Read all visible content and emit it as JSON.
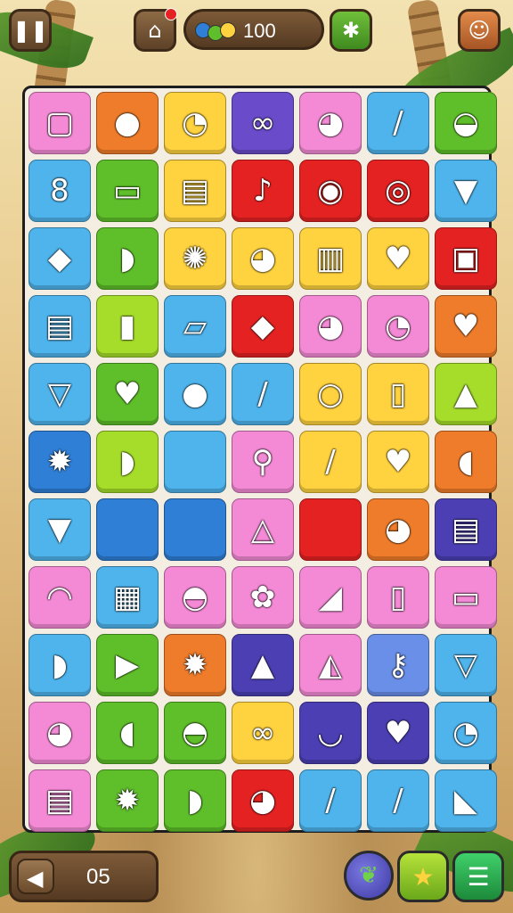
{
  "header": {
    "pause_icon": "pause-icon",
    "home_icon": "home-icon",
    "coins": "100",
    "map_icon": "world-map-icon",
    "avatar_icon": "player-avatar-icon"
  },
  "footer": {
    "back_icon": "back-arrow-icon",
    "level": "05",
    "leaf_icon": "leaf-powerup-icon",
    "star_icon": "star-icon",
    "menu_icon": "menu-icon"
  },
  "board": {
    "rows": [
      [
        {
          "c": "#f48ad6",
          "i": "tablet-icon",
          "g": "▢"
        },
        {
          "c": "#ef7c2a",
          "i": "red-monster-icon",
          "g": "●"
        },
        {
          "c": "#ffd23f",
          "i": "white-bear-icon",
          "g": "◔"
        },
        {
          "c": "#6a4bc9",
          "i": "glasses-icon",
          "g": "∞"
        },
        {
          "c": "#f48ad6",
          "i": "yellow-mouse-icon",
          "g": "◕"
        },
        {
          "c": "#4fb4ec",
          "i": "green-pen-icon",
          "g": "/"
        },
        {
          "c": "#5fbf2a",
          "i": "yellow-chick-icon",
          "g": "◒"
        }
      ],
      [
        {
          "c": "#4fb4ec",
          "i": "peanut-icon",
          "g": "8"
        },
        {
          "c": "#5fbf2a",
          "i": "scroll-icon",
          "g": "▭"
        },
        {
          "c": "#ffd23f",
          "i": "books-icon",
          "g": "▤"
        },
        {
          "c": "#e52222",
          "i": "rattle-icon",
          "g": "♪"
        },
        {
          "c": "#e52222",
          "i": "lens-icon",
          "g": "◉"
        },
        {
          "c": "#e52222",
          "i": "purple-button-icon",
          "g": "◎"
        },
        {
          "c": "#4fb4ec",
          "i": "carrot-icon",
          "g": "▼"
        }
      ],
      [
        {
          "c": "#4fb4ec",
          "i": "red-leaf-icon",
          "g": "◆"
        },
        {
          "c": "#5fbf2a",
          "i": "yellow-bird-icon",
          "g": "◗"
        },
        {
          "c": "#ffd23f",
          "i": "blue-bug-icon",
          "g": "✺"
        },
        {
          "c": "#ffd23f",
          "i": "white-cat-icon",
          "g": "◕"
        },
        {
          "c": "#ffd23f",
          "i": "napkins-icon",
          "g": "▥"
        },
        {
          "c": "#ffd23f",
          "i": "heart-icon",
          "g": "♥"
        },
        {
          "c": "#e52222",
          "i": "film-icon",
          "g": "▣"
        }
      ],
      [
        {
          "c": "#4fb4ec",
          "i": "chocolate-icon",
          "g": "▤"
        },
        {
          "c": "#a5dd2a",
          "i": "bread-icon",
          "g": "▮"
        },
        {
          "c": "#4fb4ec",
          "i": "blue-roll-icon",
          "g": "▱"
        },
        {
          "c": "#e52222",
          "i": "green-leaf-icon",
          "g": "◆"
        },
        {
          "c": "#f48ad6",
          "i": "pink-cat-icon",
          "g": "◕"
        },
        {
          "c": "#f48ad6",
          "i": "teddy-bear-icon",
          "g": "◔"
        },
        {
          "c": "#ef7c2a",
          "i": "heart-icon",
          "g": "♥"
        }
      ],
      [
        {
          "c": "#4fb4ec",
          "i": "ice-cream-icon",
          "g": "▽"
        },
        {
          "c": "#5fbf2a",
          "i": "heart-icon",
          "g": "♥"
        },
        {
          "c": "#4fb4ec",
          "i": "green-balloon-icon",
          "g": "●"
        },
        {
          "c": "#4fb4ec",
          "i": "green-marker-icon",
          "g": "/"
        },
        {
          "c": "#ffd23f",
          "i": "white-balloon-icon",
          "g": "○"
        },
        {
          "c": "#ffd23f",
          "i": "open-book-icon",
          "g": "▯"
        },
        {
          "c": "#a5dd2a",
          "i": "blue-rocket-icon",
          "g": "▲"
        }
      ],
      [
        {
          "c": "#2f7fd6",
          "i": "green-star-icon",
          "g": "✹"
        },
        {
          "c": "#a5dd2a",
          "i": "blue-bird-icon",
          "g": "◗"
        },
        {
          "c": "#4fb4ec",
          "i": "empty-tile",
          "g": ""
        },
        {
          "c": "#f48ad6",
          "i": "magnifier-icon",
          "g": "⚲"
        },
        {
          "c": "#ffd23f",
          "i": "wand-icon",
          "g": "/"
        },
        {
          "c": "#ffd23f",
          "i": "heart-icon",
          "g": "♥"
        },
        {
          "c": "#ef7c2a",
          "i": "yellow-pill-icon",
          "g": "◖"
        }
      ],
      [
        {
          "c": "#4fb4ec",
          "i": "carrot-icon",
          "g": "▼"
        },
        {
          "c": "#2f7fd6",
          "i": "empty-tile",
          "g": ""
        },
        {
          "c": "#2f7fd6",
          "i": "empty-tile",
          "g": ""
        },
        {
          "c": "#f48ad6",
          "i": "cone-icon",
          "g": "△"
        },
        {
          "c": "#e52222",
          "i": "empty-tile",
          "g": ""
        },
        {
          "c": "#ef7c2a",
          "i": "pink-bear-icon",
          "g": "◕"
        },
        {
          "c": "#4b3fb3",
          "i": "newspaper-icon",
          "g": "▤"
        }
      ],
      [
        {
          "c": "#f48ad6",
          "i": "ghost-icon",
          "g": "◠"
        },
        {
          "c": "#4fb4ec",
          "i": "notepad-icon",
          "g": "▦"
        },
        {
          "c": "#f48ad6",
          "i": "red-monster-icon",
          "g": "◓"
        },
        {
          "c": "#f48ad6",
          "i": "bird-flower-icon",
          "g": "✿"
        },
        {
          "c": "#f48ad6",
          "i": "banana-icon",
          "g": "◢"
        },
        {
          "c": "#f48ad6",
          "i": "game-console-icon",
          "g": "▯"
        },
        {
          "c": "#f48ad6",
          "i": "card-icon",
          "g": "▭"
        }
      ],
      [
        {
          "c": "#4fb4ec",
          "i": "yellow-fish-icon",
          "g": "◗"
        },
        {
          "c": "#5fbf2a",
          "i": "carrot-icon",
          "g": "▶"
        },
        {
          "c": "#ef7c2a",
          "i": "sun-icon",
          "g": "✹"
        },
        {
          "c": "#4b3fb3",
          "i": "glue-bottle-icon",
          "g": "▲"
        },
        {
          "c": "#f48ad6",
          "i": "loaf-icon",
          "g": "◭"
        },
        {
          "c": "#6a8fe8",
          "i": "pacifier-icon",
          "g": "⚷"
        },
        {
          "c": "#4fb4ec",
          "i": "ice-cream-icon",
          "g": "▽"
        }
      ],
      [
        {
          "c": "#f48ad6",
          "i": "blue-cat-icon",
          "g": "◕"
        },
        {
          "c": "#5fbf2a",
          "i": "yellow-pill-icon",
          "g": "◖"
        },
        {
          "c": "#5fbf2a",
          "i": "green-monster-icon",
          "g": "◓"
        },
        {
          "c": "#ffd23f",
          "i": "pretzel-icon",
          "g": "∞"
        },
        {
          "c": "#4b3fb3",
          "i": "basket-icon",
          "g": "◡"
        },
        {
          "c": "#4b3fb3",
          "i": "heart-icon",
          "g": "♥"
        },
        {
          "c": "#4fb4ec",
          "i": "mouse-face-icon",
          "g": "◔"
        }
      ],
      [
        {
          "c": "#f48ad6",
          "i": "red-book-icon",
          "g": "▤"
        },
        {
          "c": "#5fbf2a",
          "i": "red-sun-icon",
          "g": "✹"
        },
        {
          "c": "#5fbf2a",
          "i": "blue-bird-icon",
          "g": "◗"
        },
        {
          "c": "#e52222",
          "i": "red-bear-icon",
          "g": "◕"
        },
        {
          "c": "#4fb4ec",
          "i": "purple-pencil-icon",
          "g": "/"
        },
        {
          "c": "#4fb4ec",
          "i": "white-pen-icon",
          "g": "/"
        },
        {
          "c": "#4fb4ec",
          "i": "red-pepper-icon",
          "g": "◣"
        }
      ]
    ]
  }
}
